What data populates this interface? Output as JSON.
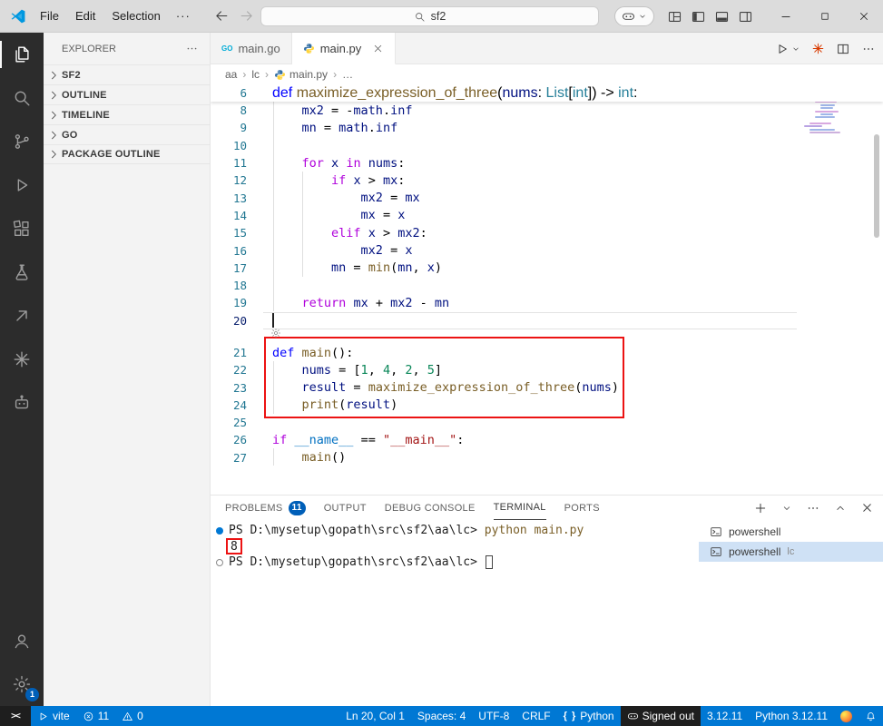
{
  "colors": {
    "accent_blue": "#005FB8",
    "status_bar_bg": "#0078D4",
    "activity_bar_bg": "#2C2C2C",
    "annotation_red": "#EC1313",
    "badge_blue": "#005FB8",
    "terminal_selection_bg": "#CFE1F5"
  },
  "title_bar": {
    "menus": [
      "File",
      "Edit",
      "Selection"
    ],
    "more_label": "···",
    "search_value": "sf2"
  },
  "activity_bar": {
    "top": [
      {
        "icon": "explorer",
        "name": "explorer",
        "active": true
      },
      {
        "icon": "search",
        "name": "search",
        "active": false
      },
      {
        "icon": "source-control",
        "name": "source-control",
        "active": false
      },
      {
        "icon": "run-debug",
        "name": "run-and-debug",
        "active": false
      },
      {
        "icon": "extensions",
        "name": "extensions",
        "active": false
      },
      {
        "icon": "beaker",
        "name": "testing",
        "active": false
      },
      {
        "icon": "arrow-up-right",
        "name": "publish",
        "active": false
      },
      {
        "icon": "starburst",
        "name": "copilot",
        "active": false
      },
      {
        "icon": "robot",
        "name": "ai-tools",
        "active": false
      }
    ],
    "bottom": [
      {
        "icon": "account",
        "name": "accounts"
      },
      {
        "icon": "gear",
        "name": "settings",
        "badge": "1"
      }
    ]
  },
  "sidebar": {
    "title": "EXPLORER",
    "sections": [
      {
        "label": "SF2"
      },
      {
        "label": "OUTLINE"
      },
      {
        "label": "TIMELINE"
      },
      {
        "label": "GO"
      },
      {
        "label": "PACKAGE OUTLINE"
      }
    ]
  },
  "editor": {
    "tabs": [
      {
        "label": "main.go",
        "icon": "go",
        "active": false,
        "closable": false
      },
      {
        "label": "main.py",
        "icon": "python",
        "active": true,
        "closable": true
      }
    ],
    "breadcrumbs": [
      "aa",
      "lc",
      "main.py",
      "…"
    ],
    "current_line": 20,
    "gap_after_line": 20,
    "sticky_line": {
      "n": "6",
      "segments": [
        [
          "def",
          "b"
        ],
        [
          " ",
          ""
        ],
        [
          "maximize_expression_of_three",
          "f"
        ],
        [
          "(",
          ""
        ],
        [
          "nums",
          "v"
        ],
        [
          ": ",
          ""
        ],
        [
          "List",
          "t"
        ],
        [
          "[",
          ""
        ],
        [
          "int",
          "t"
        ],
        [
          "]",
          ""
        ],
        [
          ") -> ",
          ""
        ],
        [
          "int",
          "t"
        ],
        [
          ":",
          ""
        ]
      ]
    },
    "lines": [
      {
        "n": 8,
        "segments": [
          [
            "    ",
            ""
          ],
          [
            "mx2",
            "v"
          ],
          [
            " = -",
            ""
          ],
          [
            "math",
            "v"
          ],
          [
            ".",
            ""
          ],
          [
            "inf",
            "v"
          ]
        ]
      },
      {
        "n": 9,
        "segments": [
          [
            "    ",
            ""
          ],
          [
            "mn",
            "v"
          ],
          [
            " = ",
            ""
          ],
          [
            "math",
            "v"
          ],
          [
            ".",
            ""
          ],
          [
            "inf",
            "v"
          ]
        ]
      },
      {
        "n": 10,
        "segments": []
      },
      {
        "n": 11,
        "segments": [
          [
            "    ",
            ""
          ],
          [
            "for",
            "k"
          ],
          [
            " ",
            ""
          ],
          [
            "x",
            "v"
          ],
          [
            " ",
            ""
          ],
          [
            "in",
            "k"
          ],
          [
            " ",
            ""
          ],
          [
            "nums",
            "v"
          ],
          [
            ":",
            ""
          ]
        ]
      },
      {
        "n": 12,
        "segments": [
          [
            "        ",
            ""
          ],
          [
            "if",
            "k"
          ],
          [
            " ",
            ""
          ],
          [
            "x",
            "v"
          ],
          [
            " > ",
            ""
          ],
          [
            "mx",
            "v"
          ],
          [
            ":",
            ""
          ]
        ]
      },
      {
        "n": 13,
        "segments": [
          [
            "            ",
            ""
          ],
          [
            "mx2",
            "v"
          ],
          [
            " = ",
            ""
          ],
          [
            "mx",
            "v"
          ]
        ]
      },
      {
        "n": 14,
        "segments": [
          [
            "            ",
            ""
          ],
          [
            "mx",
            "v"
          ],
          [
            " = ",
            ""
          ],
          [
            "x",
            "v"
          ]
        ]
      },
      {
        "n": 15,
        "segments": [
          [
            "        ",
            ""
          ],
          [
            "elif",
            "k"
          ],
          [
            " ",
            ""
          ],
          [
            "x",
            "v"
          ],
          [
            " > ",
            ""
          ],
          [
            "mx2",
            "v"
          ],
          [
            ":",
            ""
          ]
        ]
      },
      {
        "n": 16,
        "segments": [
          [
            "            ",
            ""
          ],
          [
            "mx2",
            "v"
          ],
          [
            " = ",
            ""
          ],
          [
            "x",
            "v"
          ]
        ]
      },
      {
        "n": 17,
        "segments": [
          [
            "        ",
            ""
          ],
          [
            "mn",
            "v"
          ],
          [
            " = ",
            ""
          ],
          [
            "min",
            "f"
          ],
          [
            "(",
            ""
          ],
          [
            "mn",
            "v"
          ],
          [
            ", ",
            ""
          ],
          [
            "x",
            "v"
          ],
          [
            ")",
            ""
          ]
        ]
      },
      {
        "n": 18,
        "segments": []
      },
      {
        "n": 19,
        "segments": [
          [
            "    ",
            ""
          ],
          [
            "return",
            "k"
          ],
          [
            " ",
            ""
          ],
          [
            "mx",
            "v"
          ],
          [
            " + ",
            ""
          ],
          [
            "mx2",
            "v"
          ],
          [
            " - ",
            ""
          ],
          [
            "mn",
            "v"
          ]
        ]
      },
      {
        "n": 20,
        "segments": [],
        "current": true
      },
      {
        "n": 21,
        "segments": [
          [
            "def",
            "b"
          ],
          [
            " ",
            ""
          ],
          [
            "main",
            "f"
          ],
          [
            "():",
            ""
          ]
        ]
      },
      {
        "n": 22,
        "segments": [
          [
            "    ",
            ""
          ],
          [
            "nums",
            "v"
          ],
          [
            " = [",
            ""
          ],
          [
            "1",
            "n"
          ],
          [
            ", ",
            ""
          ],
          [
            "4",
            "n"
          ],
          [
            ", ",
            ""
          ],
          [
            "2",
            "n"
          ],
          [
            ", ",
            ""
          ],
          [
            "5",
            "n"
          ],
          [
            "]",
            ""
          ]
        ]
      },
      {
        "n": 23,
        "segments": [
          [
            "    ",
            ""
          ],
          [
            "result",
            "v"
          ],
          [
            " = ",
            ""
          ],
          [
            "maximize_expression_of_three",
            "f"
          ],
          [
            "(",
            ""
          ],
          [
            "nums",
            "v"
          ],
          [
            ")",
            ""
          ]
        ]
      },
      {
        "n": 24,
        "segments": [
          [
            "    ",
            ""
          ],
          [
            "print",
            "f"
          ],
          [
            "(",
            ""
          ],
          [
            "result",
            "v"
          ],
          [
            ")",
            ""
          ]
        ]
      },
      {
        "n": 25,
        "segments": []
      },
      {
        "n": 26,
        "segments": [
          [
            "if",
            "k"
          ],
          [
            " ",
            ""
          ],
          [
            "__name__",
            "c"
          ],
          [
            " == ",
            ""
          ],
          [
            "\"__main__\"",
            "s"
          ],
          [
            ":",
            ""
          ]
        ]
      },
      {
        "n": 27,
        "segments": [
          [
            "    ",
            ""
          ],
          [
            "main",
            "f"
          ],
          [
            "()",
            ""
          ]
        ]
      }
    ]
  },
  "panel": {
    "tabs": [
      {
        "label": "PROBLEMS",
        "badge": "11",
        "active": false
      },
      {
        "label": "OUTPUT",
        "active": false
      },
      {
        "label": "DEBUG CONSOLE",
        "active": false
      },
      {
        "label": "TERMINAL",
        "active": true
      },
      {
        "label": "PORTS",
        "active": false
      }
    ],
    "terminal": {
      "lines": [
        {
          "decoration": "blue",
          "segments": [
            [
              "PS D:\\mysetup\\gopath\\src\\sf2\\aa\\lc> ",
              ""
            ],
            [
              "python main.py",
              "cmd"
            ]
          ],
          "boxed": false,
          "cursor": false
        },
        {
          "decoration": null,
          "segments": [
            [
              "8",
              ""
            ]
          ],
          "boxed": true,
          "cursor": false
        },
        {
          "decoration": "hollow",
          "segments": [
            [
              "PS D:\\mysetup\\gopath\\src\\sf2\\aa\\lc> ",
              ""
            ]
          ],
          "boxed": false,
          "cursor": true
        }
      ],
      "list": [
        {
          "label": "powershell",
          "detail": "",
          "selected": false
        },
        {
          "label": "powershell",
          "detail": "lc",
          "selected": true
        }
      ]
    }
  },
  "status_bar": {
    "left": [
      {
        "icon": "remote",
        "label": "",
        "name": "remote-indicator",
        "dark": true
      },
      {
        "icon": "play",
        "label": "vite",
        "name": "task-vite",
        "dark": false
      },
      {
        "icon": "error",
        "label": "11",
        "name": "problems-errors",
        "dark": false
      },
      {
        "icon": "warning",
        "label": "0",
        "name": "problems-warnings",
        "dark": false
      }
    ],
    "right": [
      {
        "icon": "",
        "label": "Ln 20, Col 1",
        "name": "cursor-position",
        "dark": false
      },
      {
        "icon": "",
        "label": "Spaces: 4",
        "name": "indentation",
        "dark": false
      },
      {
        "icon": "",
        "label": "UTF-8",
        "name": "encoding",
        "dark": false
      },
      {
        "icon": "",
        "label": "CRLF",
        "name": "end-of-line",
        "dark": false
      },
      {
        "icon": "braces",
        "label": "Python",
        "name": "language-mode",
        "dark": false
      },
      {
        "icon": "copilot",
        "label": "Signed out",
        "name": "copilot-status",
        "dark": true
      },
      {
        "icon": "",
        "label": "3.12.11",
        "name": "python-version",
        "dark": false
      },
      {
        "icon": "",
        "label": "Python 3.12.11",
        "name": "python-interpreter",
        "dark": false
      },
      {
        "icon": "firefox",
        "label": "",
        "name": "firefox-debug",
        "dark": false
      },
      {
        "icon": "bell",
        "label": "",
        "name": "notifications",
        "dark": false
      }
    ]
  }
}
